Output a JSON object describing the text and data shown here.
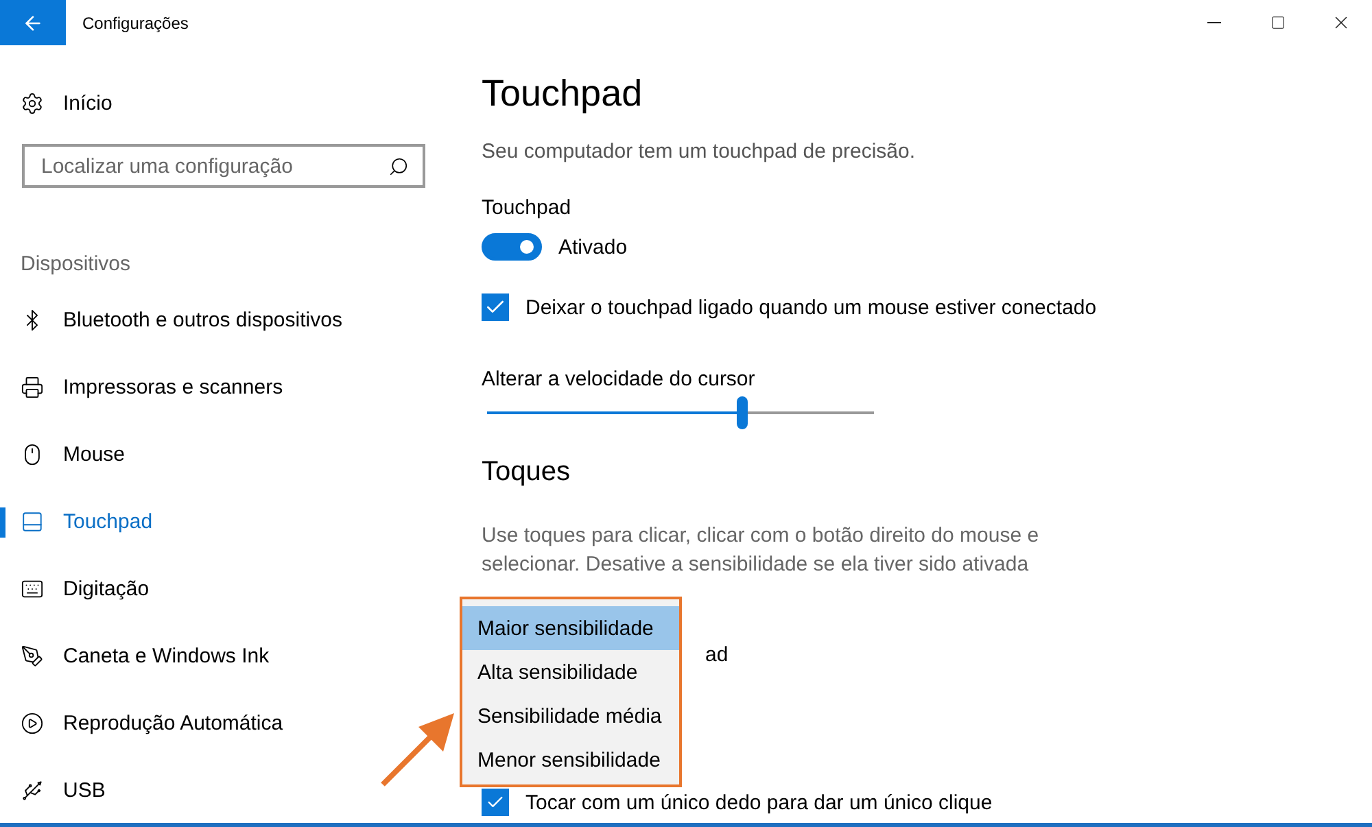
{
  "window": {
    "title": "Configurações"
  },
  "sidebar": {
    "home": "Início",
    "search": {
      "placeholder": "Localizar uma configuração"
    },
    "section": "Dispositivos",
    "items": [
      {
        "kind": "bluetooth",
        "label": "Bluetooth e outros dispositivos",
        "selected": false
      },
      {
        "kind": "printer",
        "label": "Impressoras e scanners",
        "selected": false
      },
      {
        "kind": "mouse",
        "label": "Mouse",
        "selected": false
      },
      {
        "kind": "touchpad",
        "label": "Touchpad",
        "selected": true
      },
      {
        "kind": "keyboard",
        "label": "Digitação",
        "selected": false
      },
      {
        "kind": "pen",
        "label": "Caneta e Windows Ink",
        "selected": false
      },
      {
        "kind": "autoplay",
        "label": "Reprodução Automática",
        "selected": false
      },
      {
        "kind": "usb",
        "label": "USB",
        "selected": false
      }
    ]
  },
  "content": {
    "title": "Touchpad",
    "subtitle": "Seu computador tem um touchpad de precisão.",
    "toggle": {
      "label": "Touchpad",
      "on": true,
      "state_text": "Ativado"
    },
    "keep_on": {
      "label": "Deixar o touchpad ligado quando um mouse estiver conectado",
      "checked": true
    },
    "speed": {
      "label": "Alterar a velocidade do cursor",
      "level": 0.66
    },
    "taps": {
      "heading": "Toques",
      "description": "Use toques para clicar, clicar com o botão direito do mouse e selecionar. Desative a sensibilidade se ela tiver sido ativada",
      "covered_text": "ad",
      "single_tap": {
        "label": "Tocar com um único dedo para dar um único clique",
        "checked": true
      }
    },
    "dropdown": {
      "options": [
        {
          "label": "Maior sensibilidade",
          "selected": true
        },
        {
          "label": "Alta sensibilidade",
          "selected": false
        },
        {
          "label": "Sensibilidade média",
          "selected": false
        },
        {
          "label": "Menor sensibilidade",
          "selected": false
        }
      ]
    }
  }
}
